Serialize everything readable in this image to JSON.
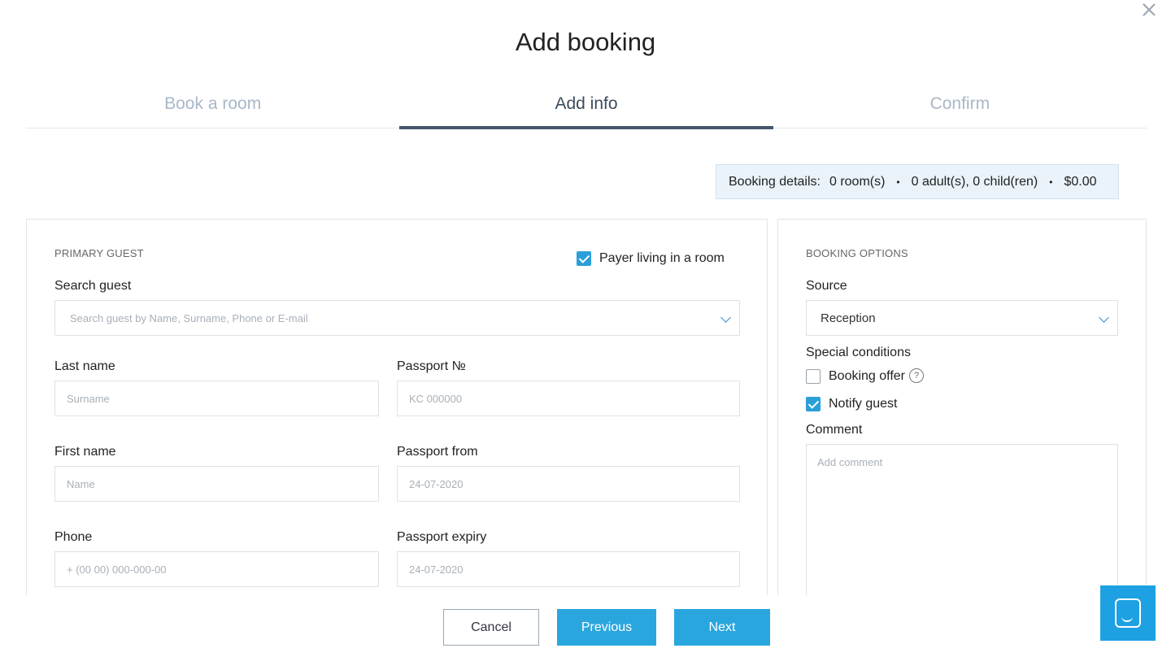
{
  "modal": {
    "title": "Add booking"
  },
  "steps": [
    {
      "label": "Book a room",
      "active": false
    },
    {
      "label": "Add info",
      "active": true
    },
    {
      "label": "Confirm",
      "active": false
    }
  ],
  "summary": {
    "label": "Booking details:",
    "rooms": "0 room(s)",
    "guests": "0 adult(s), 0 child(ren)",
    "total": "$0.00",
    "separator": "•"
  },
  "primary_guest": {
    "section_title": "PRIMARY GUEST",
    "payer_living": {
      "label": "Payer living in a room",
      "checked": true
    },
    "search": {
      "label": "Search guest",
      "placeholder": "Search guest by Name, Surname, Phone or E-mail"
    },
    "last_name": {
      "label": "Last name",
      "placeholder": "Surname"
    },
    "first_name": {
      "label": "First name",
      "placeholder": "Name"
    },
    "phone": {
      "label": "Phone",
      "placeholder": "+ (00 00) 000-000-00"
    },
    "passport_no": {
      "label": "Passport №",
      "placeholder": "KC 000000"
    },
    "passport_from": {
      "label": "Passport from",
      "placeholder": "24-07-2020"
    },
    "passport_expiry": {
      "label": "Passport expiry",
      "placeholder": "24-07-2020"
    }
  },
  "booking_options": {
    "section_title": "BOOKING OPTIONS",
    "source": {
      "label": "Source",
      "value": "Reception"
    },
    "special_conditions": {
      "label": "Special conditions",
      "booking_offer": {
        "label": "Booking offer",
        "checked": false,
        "help": "?"
      },
      "notify_guest": {
        "label": "Notify guest",
        "checked": true
      }
    },
    "comment": {
      "label": "Comment",
      "placeholder": "Add comment"
    }
  },
  "footer": {
    "cancel_label": "Cancel",
    "previous_label": "Previous",
    "next_label": "Next"
  },
  "colors": {
    "accent": "#2aa6de",
    "step_active": "#44566b",
    "step_inactive": "#a8b7c7",
    "summary_bg": "#eaf3fa"
  },
  "icons": {
    "close": "close-icon",
    "chevron": "chevron-down-icon",
    "help": "help-circle-icon",
    "chat": "chat-icon"
  }
}
